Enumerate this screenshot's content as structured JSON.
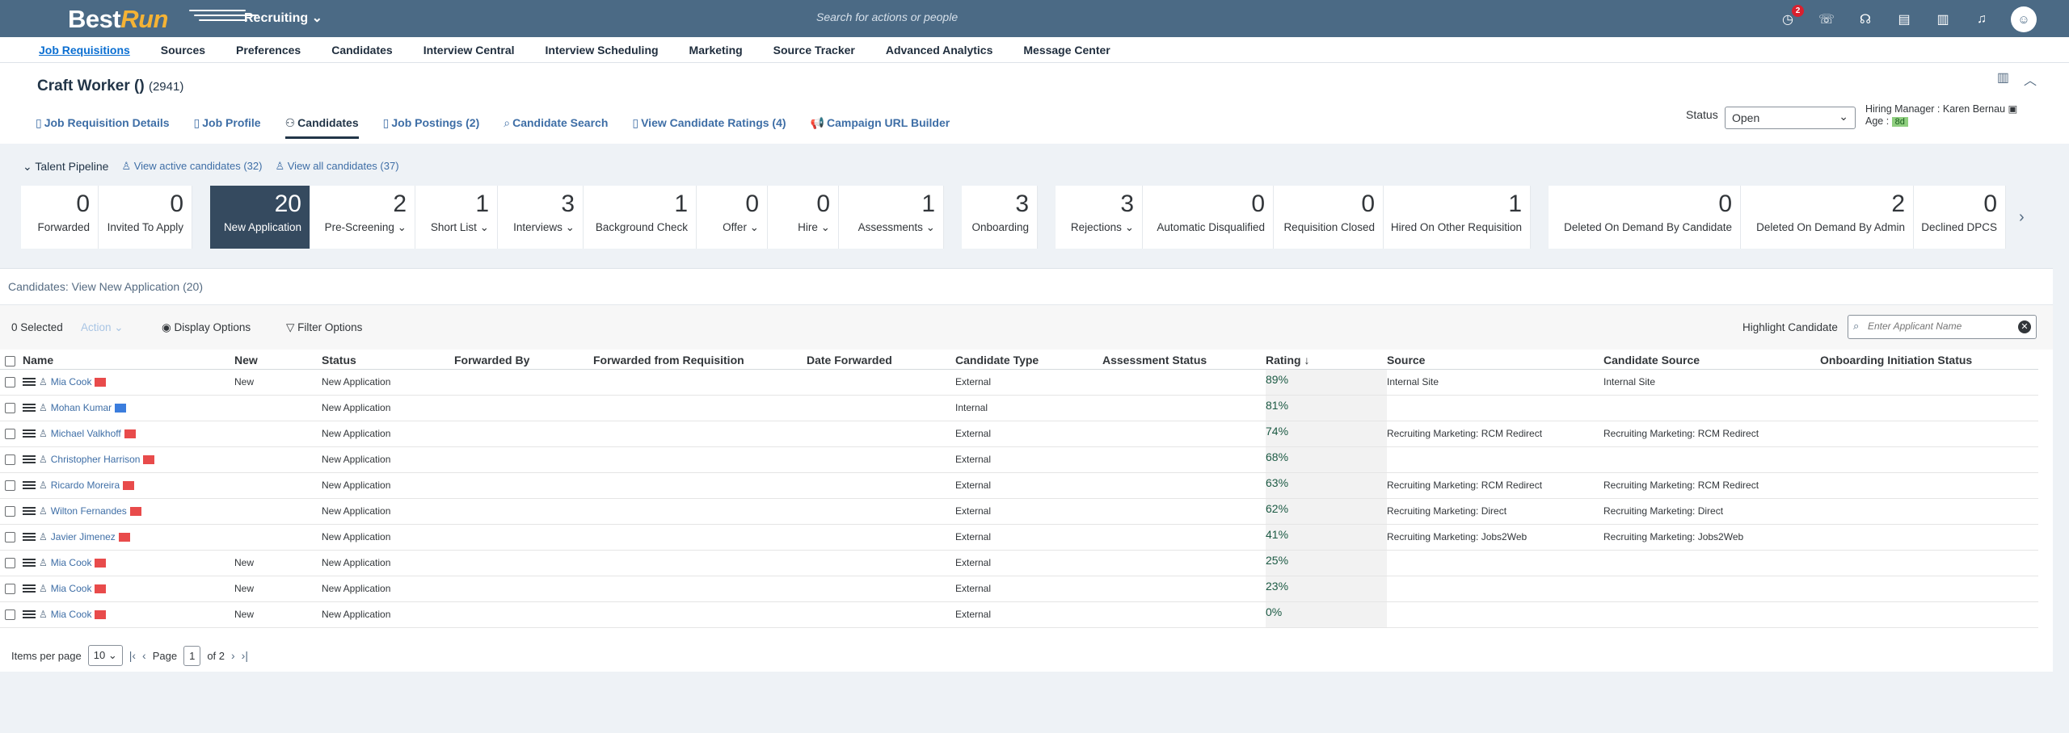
{
  "shell": {
    "logo_best": "Best",
    "logo_run": "Run",
    "module": "Recruiting",
    "search_placeholder": "Search for actions or people",
    "notification_count": "2"
  },
  "topnav": [
    "Job Requisitions",
    "Sources",
    "Preferences",
    "Candidates",
    "Interview Central",
    "Interview Scheduling",
    "Marketing",
    "Source Tracker",
    "Advanced Analytics",
    "Message Center"
  ],
  "header": {
    "title": "Craft Worker ()",
    "count": "(2941)",
    "tabs": [
      {
        "icon": "▯",
        "label": "Job Requisition Details"
      },
      {
        "icon": "▯",
        "label": "Job Profile"
      },
      {
        "icon": "⚇",
        "label": "Candidates"
      },
      {
        "icon": "▯",
        "label": "Job Postings (2)"
      },
      {
        "icon": "⌕",
        "label": "Candidate Search"
      },
      {
        "icon": "▯",
        "label": "View Candidate Ratings (4)"
      },
      {
        "icon": "📢",
        "label": "Campaign URL Builder"
      }
    ],
    "status_label": "Status",
    "status_value": "Open",
    "hiring_manager_label": "Hiring Manager :",
    "hiring_manager": "Karen Bernau",
    "age_label": "Age :",
    "age_value": "8d"
  },
  "pipeline": {
    "label": "Talent Pipeline",
    "view_active": "View active candidates (32)",
    "view_all": "View all candidates (37)",
    "groups": [
      [
        {
          "num": "0",
          "label": "Forwarded"
        },
        {
          "num": "0",
          "label": "Invited To Apply"
        }
      ],
      [
        {
          "num": "20",
          "label": "New Application",
          "selected": true
        },
        {
          "num": "2",
          "label": "Pre-Screening ⌄"
        },
        {
          "num": "1",
          "label": "Short List ⌄"
        },
        {
          "num": "3",
          "label": "Interviews ⌄"
        },
        {
          "num": "1",
          "label": "Background Check"
        },
        {
          "num": "0",
          "label": "Offer ⌄"
        },
        {
          "num": "0",
          "label": "Hire ⌄"
        },
        {
          "num": "1",
          "label": "Assessments ⌄"
        }
      ],
      [
        {
          "num": "3",
          "label": "Onboarding"
        }
      ],
      [
        {
          "num": "3",
          "label": "Rejections ⌄"
        },
        {
          "num": "0",
          "label": "Automatic Disqualified"
        },
        {
          "num": "0",
          "label": "Requisition Closed"
        },
        {
          "num": "1",
          "label": "Hired On Other Requisition"
        }
      ],
      [
        {
          "num": "0",
          "label": "Deleted On Demand By Candidate"
        },
        {
          "num": "2",
          "label": "Deleted On Demand By Admin"
        },
        {
          "num": "0",
          "label": "Declined DPCS"
        }
      ]
    ]
  },
  "list": {
    "title": "Candidates: View New Application (20)",
    "selected": "0 Selected",
    "action": "Action ⌄",
    "display_options": "Display Options",
    "filter_options": "Filter Options",
    "highlight_label": "Highlight Candidate",
    "highlight_placeholder": "Enter Applicant Name",
    "columns": [
      "Name",
      "New",
      "Status",
      "Forwarded By",
      "Forwarded from Requisition",
      "Date Forwarded",
      "Candidate Type",
      "Assessment Status",
      "Rating ↓",
      "Source",
      "Candidate Source",
      "Onboarding Initiation Status"
    ],
    "rows": [
      {
        "name": "Mia Cook",
        "flag": "red",
        "new": "New",
        "status": "New Application",
        "type": "External",
        "rating": "89%",
        "source": "Internal Site",
        "csource": "Internal Site"
      },
      {
        "name": "Mohan Kumar",
        "flag": "blue",
        "new": "",
        "status": "New Application",
        "type": "Internal",
        "rating": "81%",
        "source": "",
        "csource": ""
      },
      {
        "name": "Michael Valkhoff",
        "flag": "red",
        "new": "",
        "status": "New Application",
        "type": "External",
        "rating": "74%",
        "source": "Recruiting Marketing: RCM Redirect",
        "csource": "Recruiting Marketing: RCM Redirect"
      },
      {
        "name": "Christopher Harrison",
        "flag": "red",
        "new": "",
        "status": "New Application",
        "type": "External",
        "rating": "68%",
        "source": "",
        "csource": ""
      },
      {
        "name": "Ricardo Moreira",
        "flag": "red",
        "new": "",
        "status": "New Application",
        "type": "External",
        "rating": "63%",
        "source": "Recruiting Marketing: RCM Redirect",
        "csource": "Recruiting Marketing: RCM Redirect"
      },
      {
        "name": "Wilton Fernandes",
        "flag": "red",
        "new": "",
        "status": "New Application",
        "type": "External",
        "rating": "62%",
        "source": "Recruiting Marketing: Direct",
        "csource": "Recruiting Marketing: Direct"
      },
      {
        "name": "Javier Jimenez",
        "flag": "red",
        "new": "",
        "status": "New Application",
        "type": "External",
        "rating": "41%",
        "source": "Recruiting Marketing: Jobs2Web",
        "csource": "Recruiting Marketing: Jobs2Web"
      },
      {
        "name": "Mia Cook",
        "flag": "red",
        "new": "New",
        "status": "New Application",
        "type": "External",
        "rating": "25%",
        "source": "",
        "csource": ""
      },
      {
        "name": "Mia Cook",
        "flag": "red",
        "new": "New",
        "status": "New Application",
        "type": "External",
        "rating": "23%",
        "source": "",
        "csource": ""
      },
      {
        "name": "Mia Cook",
        "flag": "red",
        "new": "New",
        "status": "New Application",
        "type": "External",
        "rating": "0%",
        "source": "",
        "csource": ""
      }
    ]
  },
  "pager": {
    "items_label": "Items per page",
    "items_value": "10",
    "page_label": "Page",
    "page_value": "1",
    "of_label": "of 2"
  }
}
